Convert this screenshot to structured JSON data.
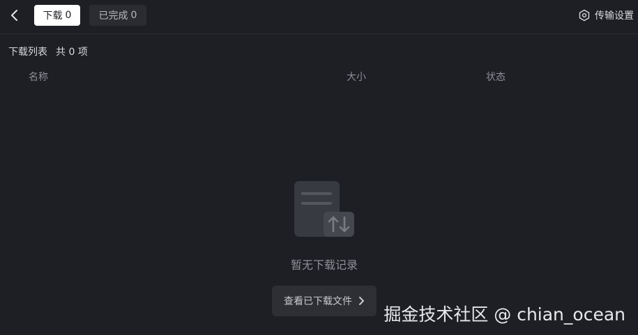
{
  "header": {
    "back_icon": "chevron-left-icon",
    "tabs": [
      {
        "label": "下载",
        "count": "0",
        "active": true
      },
      {
        "label": "已完成",
        "count": "0",
        "active": false
      }
    ],
    "settings_label": "传输设置",
    "settings_icon": "gear-icon"
  },
  "list": {
    "title": "下载列表",
    "count_text": "共 0 项",
    "columns": [
      "名称",
      "大小",
      "状态"
    ]
  },
  "empty": {
    "icon": "download-records-empty-icon",
    "message": "暂无下载记录",
    "action_label": "查看已下载文件",
    "action_icon": "chevron-right-icon"
  },
  "watermark": "掘金技术社区 @ chian_ocean",
  "colors": {
    "background": "#1e1f24",
    "tab_active_bg": "#ffffff",
    "tab_inactive_bg": "#2b2c31",
    "muted_text": "#8e9097"
  }
}
